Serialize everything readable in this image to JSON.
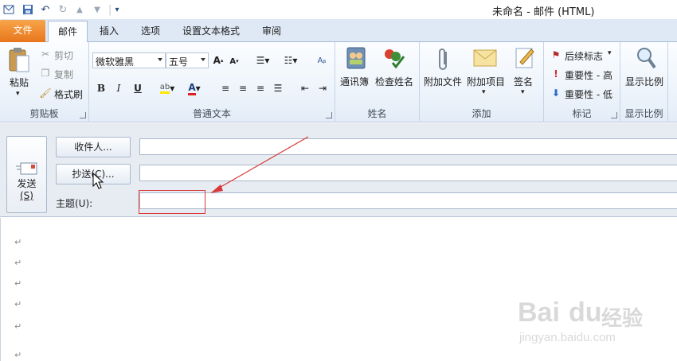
{
  "window": {
    "title": "未命名 - 邮件 (HTML)"
  },
  "tabs": [
    {
      "label": "文件"
    },
    {
      "label": "邮件"
    },
    {
      "label": "插入"
    },
    {
      "label": "选项"
    },
    {
      "label": "设置文本格式"
    },
    {
      "label": "审阅"
    }
  ],
  "ribbon": {
    "clipboard": {
      "label": "剪贴板",
      "paste": "粘贴",
      "cut": "剪切",
      "copy": "复制",
      "format_painter": "格式刷"
    },
    "basic_text": {
      "label": "普通文本",
      "font": "微软雅黑",
      "size": "五号"
    },
    "names": {
      "label": "姓名",
      "address_book": "通讯簿",
      "check_names": "检查姓名"
    },
    "include": {
      "label": "添加",
      "attach_file": "附加文件",
      "attach_item": "附加项目",
      "signature": "签名"
    },
    "tags": {
      "label": "标记",
      "follow_up": "后续标志",
      "high": "重要性 - 高",
      "low": "重要性 - 低"
    },
    "zoom": {
      "label": "显示比例",
      "zoom": "显示比例"
    }
  },
  "message": {
    "send": "发送",
    "send_key": "(S)",
    "to_button": "收件人...",
    "cc_button": "抄送(C)...",
    "subject_label": "主题(U):",
    "to_value": "",
    "cc_value": "",
    "subject_value": "",
    "paragraph_mark": "↵"
  },
  "watermark": {
    "brand": "Bai",
    "brand_end": "du",
    "product": "经验",
    "url": "jingyan.baidu.com"
  },
  "colors": {
    "file_tab": "#e8761c",
    "highlight_red": "#d83a3a",
    "ribbon_bg": "#eef4fb"
  }
}
